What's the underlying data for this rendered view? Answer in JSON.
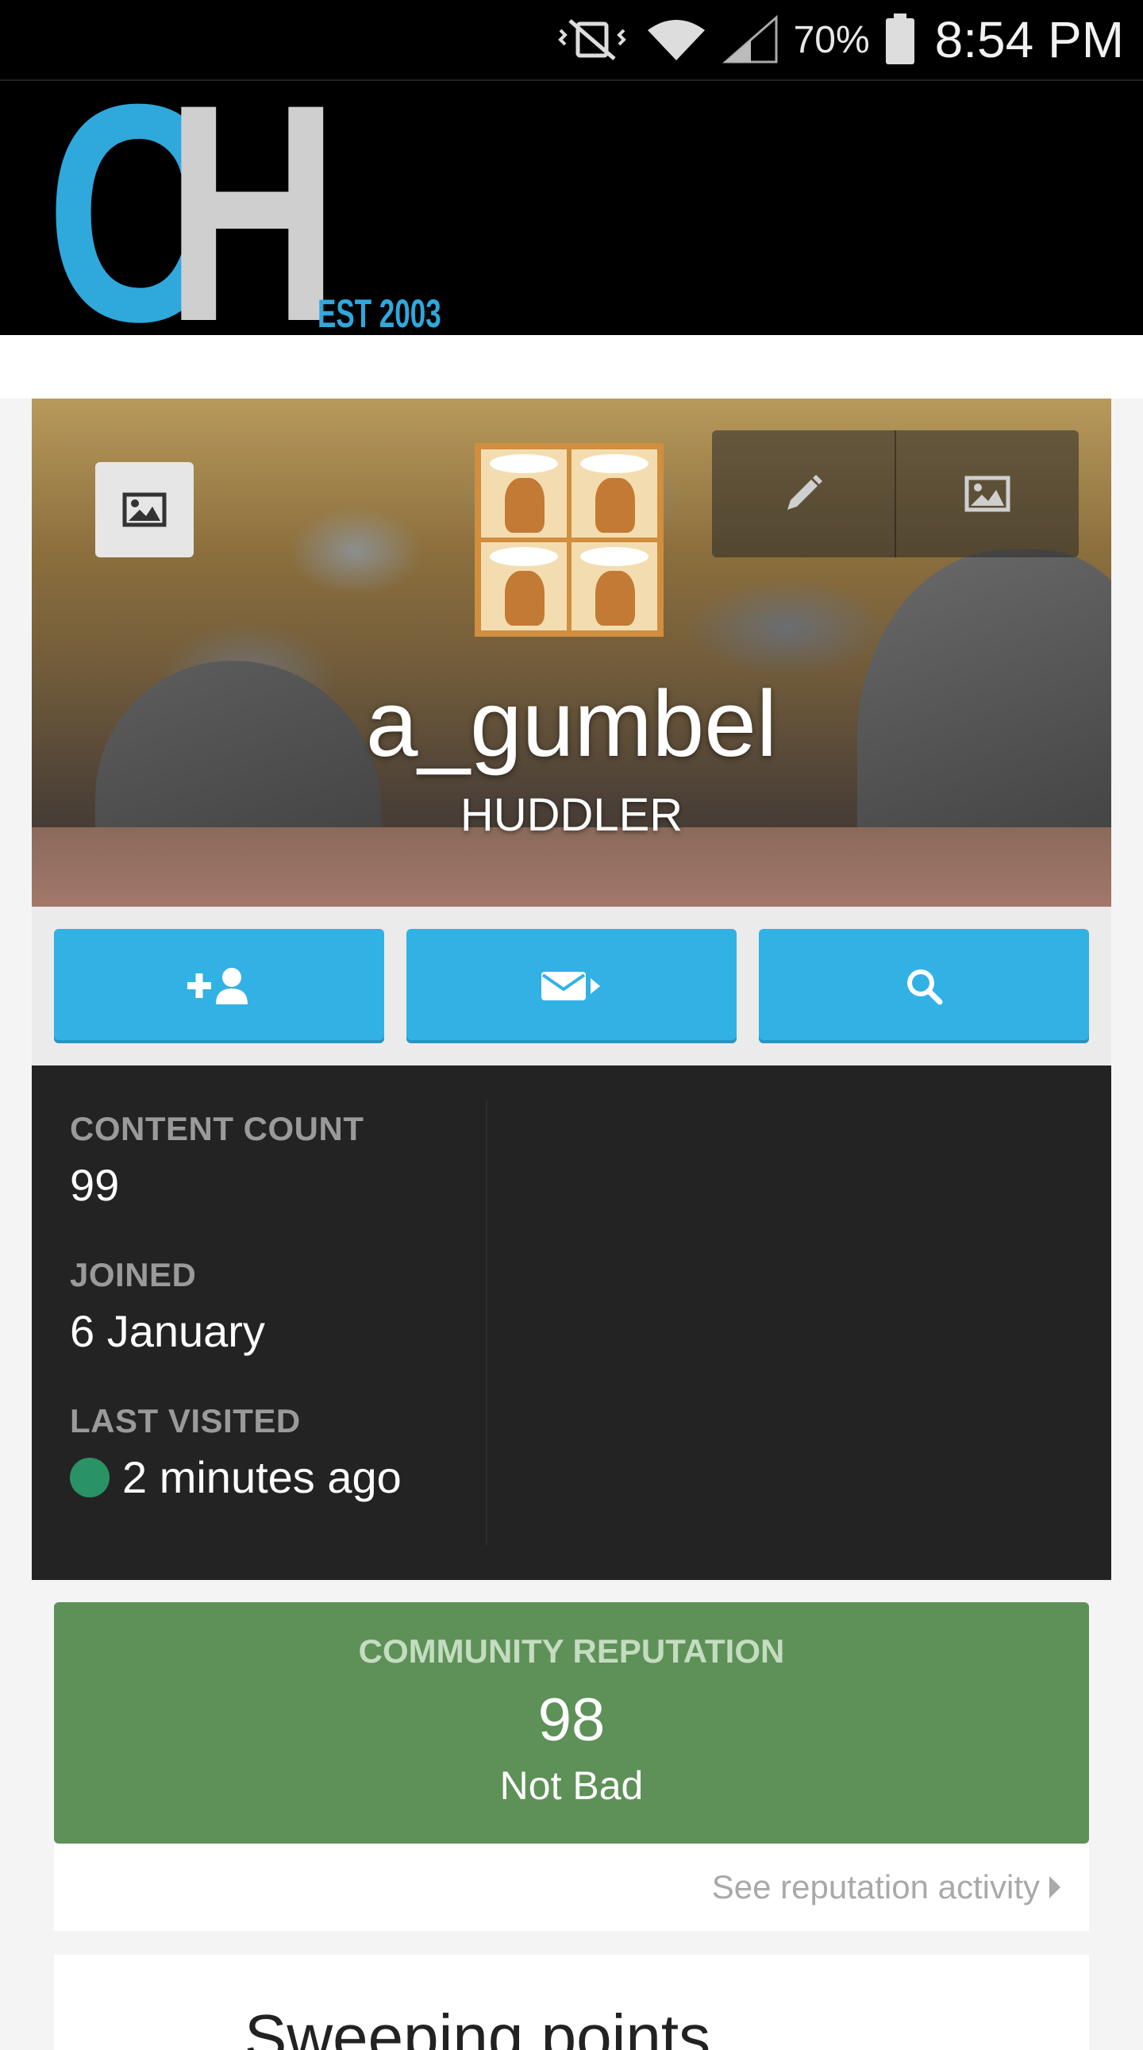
{
  "status_bar": {
    "battery_percent": "70%",
    "time": "8:54 PM",
    "icons": [
      "vibrate-mute-icon",
      "wifi-icon",
      "signal-icon",
      "battery-icon"
    ]
  },
  "site_header": {
    "logo_letters_1": "C",
    "logo_letters_2": "H",
    "logo_tagline": "EST 2003",
    "colors": {
      "logo_blue": "#2fa8dc",
      "logo_grey": "#cfcfcf"
    }
  },
  "profile": {
    "username": "a_gumbel",
    "group": "HUDDLER",
    "cover_buttons": [
      "image-icon",
      "pencil-icon",
      "image-icon"
    ]
  },
  "actions": {
    "buttons": [
      "add-friend-icon",
      "message-icon",
      "search-icon"
    ],
    "color": "#31b1e4"
  },
  "stats": {
    "content_count_label": "CONTENT COUNT",
    "content_count": "99",
    "joined_label": "JOINED",
    "joined": "6 January",
    "last_visited_label": "LAST VISITED",
    "last_visited": "2 minutes ago",
    "online_color": "#2a9366"
  },
  "reputation": {
    "label": "COMMUNITY REPUTATION",
    "value": "98",
    "text": "Not Bad",
    "link": "See reputation activity",
    "color": "#5e9158"
  },
  "next_card": {
    "partial_text": "Sweeping points"
  }
}
